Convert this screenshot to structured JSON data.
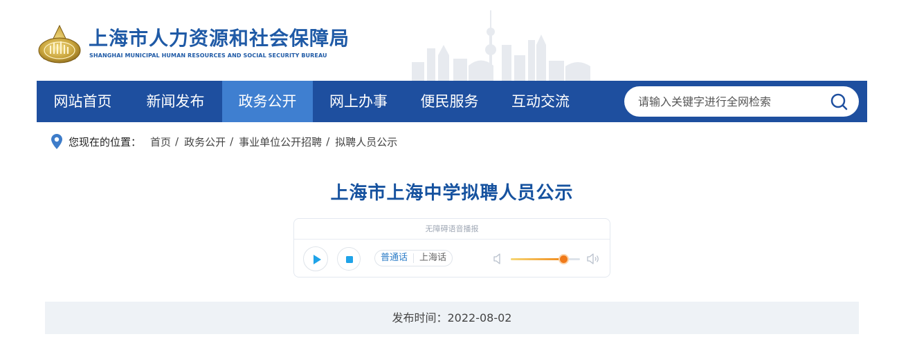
{
  "header": {
    "title": "上海市人力资源和社会保障局",
    "subtitle": "SHANGHAI MUNICIPAL HUMAN RESOURCES AND SOCIAL SECURITY BUREAU",
    "emblem_icon": "bureau-emblem-icon"
  },
  "nav": {
    "items": [
      {
        "label": "网站首页",
        "active": false
      },
      {
        "label": "新闻发布",
        "active": false
      },
      {
        "label": "政务公开",
        "active": true
      },
      {
        "label": "网上办事",
        "active": false
      },
      {
        "label": "便民服务",
        "active": false
      },
      {
        "label": "互动交流",
        "active": false
      }
    ],
    "search_placeholder": "请输入关键字进行全网检索",
    "search_icon": "search-icon",
    "bg_color": "#1e4f9f",
    "active_color": "#3f7fd0"
  },
  "breadcrumb": {
    "label": "您现在的位置：",
    "items": [
      "首页",
      "政务公开",
      "事业单位公开招聘",
      "拟聘人员公示"
    ],
    "separator": "/",
    "icon": "location-pin-icon"
  },
  "article": {
    "title": "上海市上海中学拟聘人员公示",
    "publish_time": "发布时间：2022-08-02"
  },
  "player": {
    "header": "无障碍语音播报",
    "languages": [
      {
        "label": "普通话",
        "active": true
      },
      {
        "label": "上海话",
        "active": false
      }
    ],
    "volume_percent": 76,
    "icons": [
      "play-icon",
      "stop-icon",
      "volume-low-icon",
      "volume-high-icon"
    ]
  },
  "colors": {
    "brand_blue": "#1f5aa6",
    "title_blue": "#16529f",
    "publish_bg": "#eef2f6"
  }
}
